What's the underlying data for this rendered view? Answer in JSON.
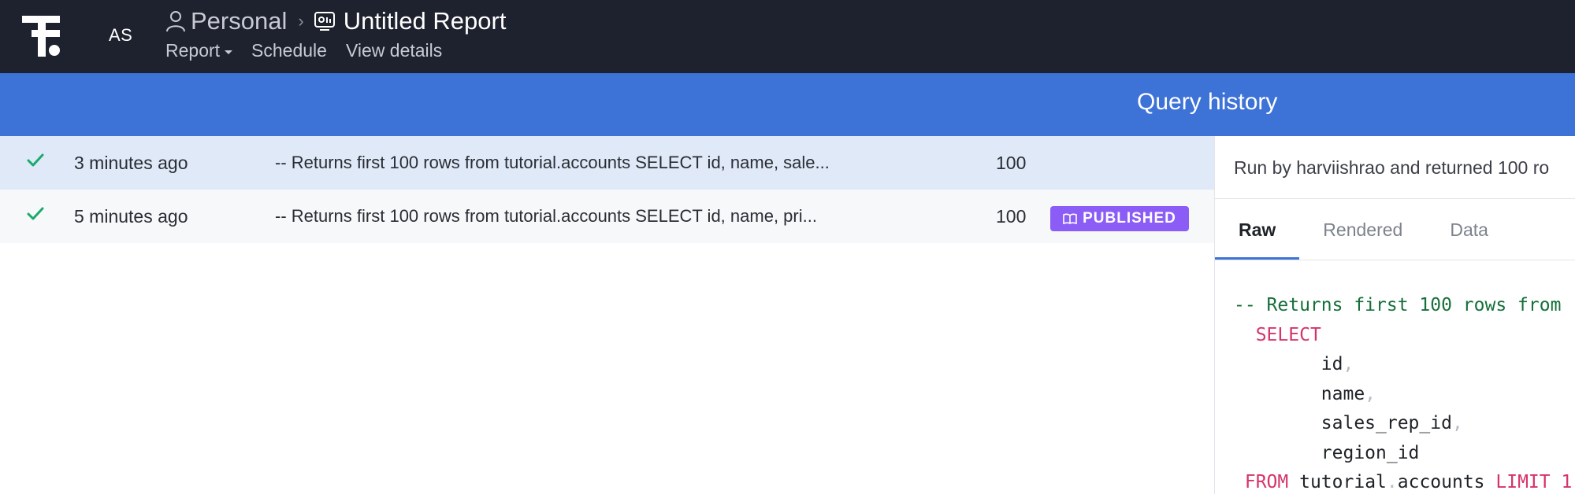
{
  "app": {
    "avatar_initials": "AS",
    "breadcrumb": {
      "space": "Personal",
      "report_title": "Untitled Report"
    },
    "subnav": {
      "report": "Report",
      "schedule": "Schedule",
      "view_details": "View details"
    }
  },
  "query_history": {
    "title": "Query history",
    "rows": [
      {
        "time": "3 minutes ago",
        "sql": "-- Returns first 100 rows from tutorial.accounts SELECT id, name, sale...",
        "rows_returned": "100",
        "badge": ""
      },
      {
        "time": "5 minutes ago",
        "sql": "-- Returns first 100 rows from tutorial.accounts SELECT id, name, pri...",
        "rows_returned": "100",
        "badge": "PUBLISHED"
      }
    ]
  },
  "detail": {
    "run_info": "Run by harviishrao and returned 100 ro",
    "tabs": [
      "Raw",
      "Rendered",
      "Data"
    ],
    "code": {
      "comment": "-- Returns first 100 rows from",
      "select": "SELECT",
      "col1": "id",
      "col2": "name",
      "col3": "sales_rep_id",
      "col4": "region_id",
      "from": "FROM",
      "table_schema": "tutorial",
      "table_name": "accounts",
      "limit": "LIMIT",
      "limit_tail": "1"
    }
  },
  "colors": {
    "topbar": "#1e222e",
    "header_blue": "#3d72d7",
    "selected_row": "#dfe9f8",
    "success_check": "#1aaa6b",
    "published_badge": "#8b5df6",
    "sql_keyword": "#d6336c",
    "sql_comment": "#16703a"
  },
  "icons": {
    "logo": "mode-logo",
    "space": "person-icon",
    "report": "report-icon",
    "status": "check-icon",
    "badge": "book-icon"
  }
}
